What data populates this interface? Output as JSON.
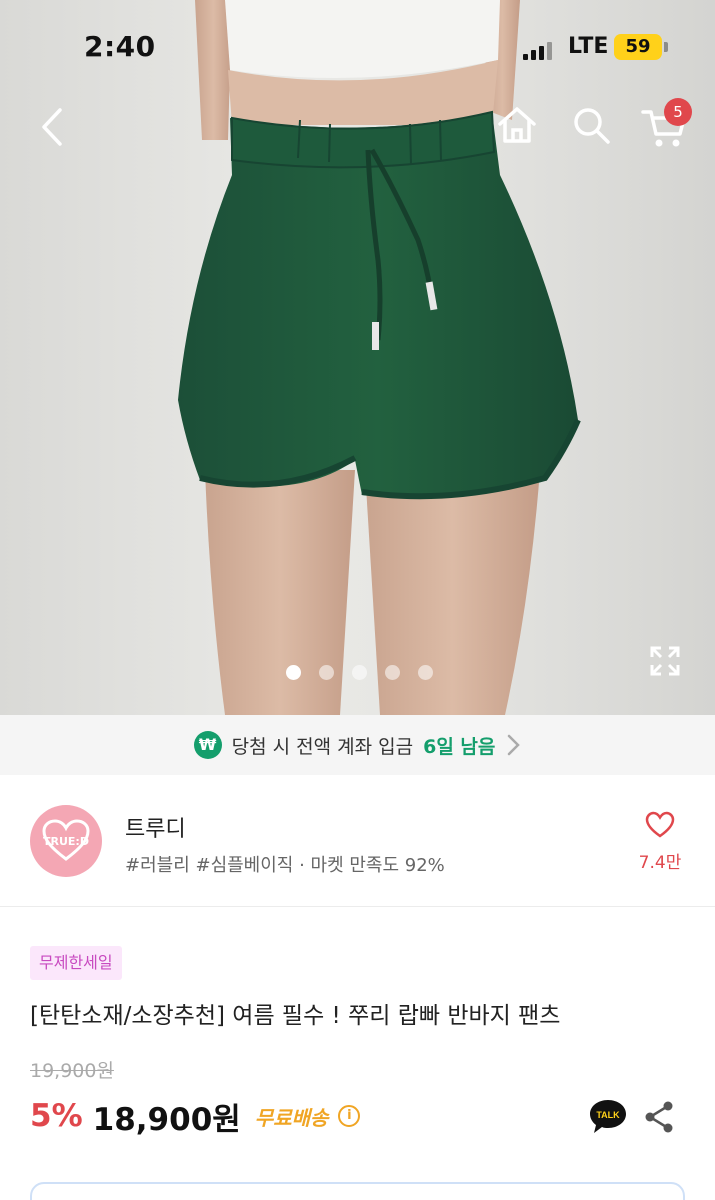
{
  "status_bar": {
    "time": "2:40",
    "network": "LTE",
    "battery": "59"
  },
  "nav": {
    "cart_count": "5"
  },
  "gallery": {
    "total_images": 5,
    "active_index": 0
  },
  "event_banner": {
    "currency_symbol": "₩",
    "text": "당첨 시 전액 계좌 입금",
    "highlight": "6일 남음",
    "accent_color": "#149e6c"
  },
  "store": {
    "name": "트루디",
    "logo_text": "TRUE:D",
    "tags": "#러블리 #심플베이직 · 마켓 만족도 92%",
    "likes": "7.4만",
    "logo_color": "#f4a7b4"
  },
  "product": {
    "badge": "무제한세일",
    "title": "[탄탄소재/소장추천] 여름 필수 ! 쭈리 랍빠 반바지 팬츠",
    "original_price": "19,900원",
    "discount": "5%",
    "price": "18,900원",
    "shipping": "무료배송",
    "info_symbol": "i",
    "talk_label": "TALK",
    "accent_color": "#e0474c"
  }
}
